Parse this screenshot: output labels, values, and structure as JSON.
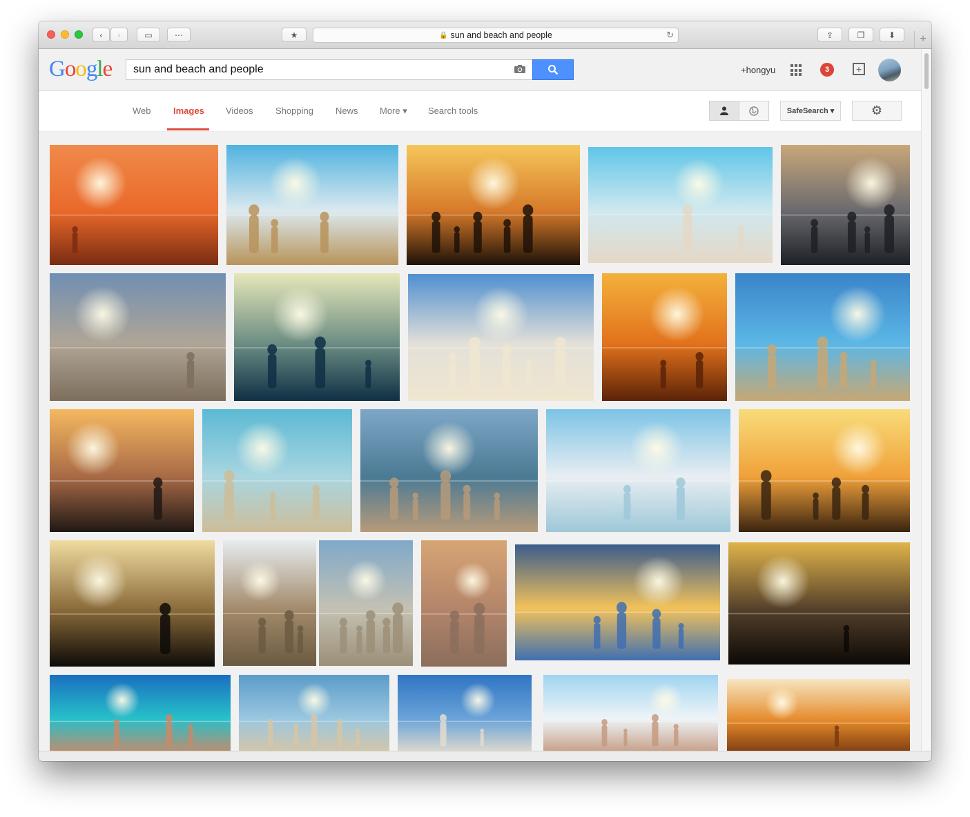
{
  "browser": {
    "url_text": "sun and beach and people",
    "back_icon": "‹",
    "forward_icon": "›",
    "sidebar_icon": "▭",
    "topsites_icon": "⋯",
    "reader_icon": "★",
    "share_icon": "⇪",
    "tabs_icon": "❐",
    "download_icon": "⬇",
    "newtab_icon": "+",
    "reload_icon": "↻",
    "lock_icon": "🔒"
  },
  "google": {
    "logo_letters": [
      "G",
      "o",
      "o",
      "g",
      "l",
      "e"
    ],
    "query": "sun and beach and people",
    "user_label": "+hongyu",
    "notification_count": "3"
  },
  "nav": {
    "web": "Web",
    "images": "Images",
    "videos": "Videos",
    "shopping": "Shopping",
    "news": "News",
    "more": "More ▾",
    "search_tools": "Search tools",
    "safesearch": "SafeSearch ▾"
  },
  "colors": {
    "accent_red": "#dd4b39",
    "search_blue": "#4d90fe",
    "notif_red": "#db4437"
  },
  "image_results": [
    {
      "kind": "sunset-runners",
      "colors": [
        "#f08a4b",
        "#e9692a",
        "#7a2c12"
      ]
    },
    {
      "kind": "beach-scarf",
      "colors": [
        "#4fb3e0",
        "#dbe9ef",
        "#b8935a"
      ]
    },
    {
      "kind": "sunset-island",
      "colors": [
        "#f5c65a",
        "#d77a2a",
        "#1e1208"
      ]
    },
    {
      "kind": "friends-walking",
      "colors": [
        "#5fc6e8",
        "#cfe8ef",
        "#e5d8c6"
      ]
    },
    {
      "kind": "jump-silhouette",
      "colors": [
        "#c9a77a",
        "#6a6a6e",
        "#1d2026"
      ]
    },
    {
      "kind": "crowded-beach",
      "colors": [
        "#6f8fb3",
        "#b0a596",
        "#7d6e5c"
      ]
    },
    {
      "kind": "hazy-sun-sea",
      "colors": [
        "#e6e7b9",
        "#6c8d83",
        "#0f2f45"
      ]
    },
    {
      "kind": "couple-umbrella",
      "colors": [
        "#4f8fd0",
        "#e3e0d8",
        "#f0e6d0"
      ]
    },
    {
      "kind": "orange-sunset",
      "colors": [
        "#f3b13b",
        "#e2721c",
        "#5b2307"
      ]
    },
    {
      "kind": "yellow-umbrella",
      "colors": [
        "#3a84c9",
        "#5bb7e6",
        "#c7a774"
      ]
    },
    {
      "kind": "sunset-waves",
      "colors": [
        "#f5b860",
        "#a86a46",
        "#201815"
      ]
    },
    {
      "kind": "golden-figures",
      "colors": [
        "#5cb9d4",
        "#a9d6e1",
        "#cdbd99"
      ]
    },
    {
      "kind": "busy-shore",
      "colors": [
        "#7ea7c7",
        "#4b7a94",
        "#b69a7a"
      ]
    },
    {
      "kind": "women-umbrella",
      "colors": [
        "#7cc3e6",
        "#e8eef2",
        "#9dc8d8"
      ]
    },
    {
      "kind": "dancing-silhouette",
      "colors": [
        "#f8dc7a",
        "#f0a13a",
        "#3a2410"
      ]
    },
    {
      "kind": "man-sunburst",
      "colors": [
        "#f0dca0",
        "#8a6a3a",
        "#0d0b08"
      ]
    },
    {
      "kind": "woman-rocks",
      "colors": [
        "#e6ecf0",
        "#a38a6a",
        "#6b5a42"
      ]
    },
    {
      "kind": "beach-towels",
      "colors": [
        "#7fa9c9",
        "#c4c1b3",
        "#9c8f78"
      ]
    },
    {
      "kind": "rio-beach",
      "colors": [
        "#d7a574",
        "#b3846a",
        "#8a6e5c"
      ]
    },
    {
      "kind": "sunset-leap",
      "colors": [
        "#3a5c8c",
        "#f3c25a",
        "#3f6fb0"
      ]
    },
    {
      "kind": "party-silhouettes",
      "colors": [
        "#e0b44a",
        "#54402a",
        "#0c0906"
      ]
    },
    {
      "kind": "sunscreen-shoulder",
      "colors": [
        "#1a6fc0",
        "#27c0c9",
        "#c88a6a"
      ]
    },
    {
      "kind": "sunhat",
      "colors": [
        "#5b9cc9",
        "#9ac7e0",
        "#d7c6a4"
      ]
    },
    {
      "kind": "palm-tree",
      "colors": [
        "#2f75c4",
        "#6aa3d8",
        "#e3dccd"
      ]
    },
    {
      "kind": "friends-selfie",
      "colors": [
        "#9fd4f0",
        "#eef4f8",
        "#c49a80"
      ]
    },
    {
      "kind": "party-jump",
      "colors": [
        "#f7e6c0",
        "#e48a2a",
        "#7a3a10"
      ]
    }
  ]
}
